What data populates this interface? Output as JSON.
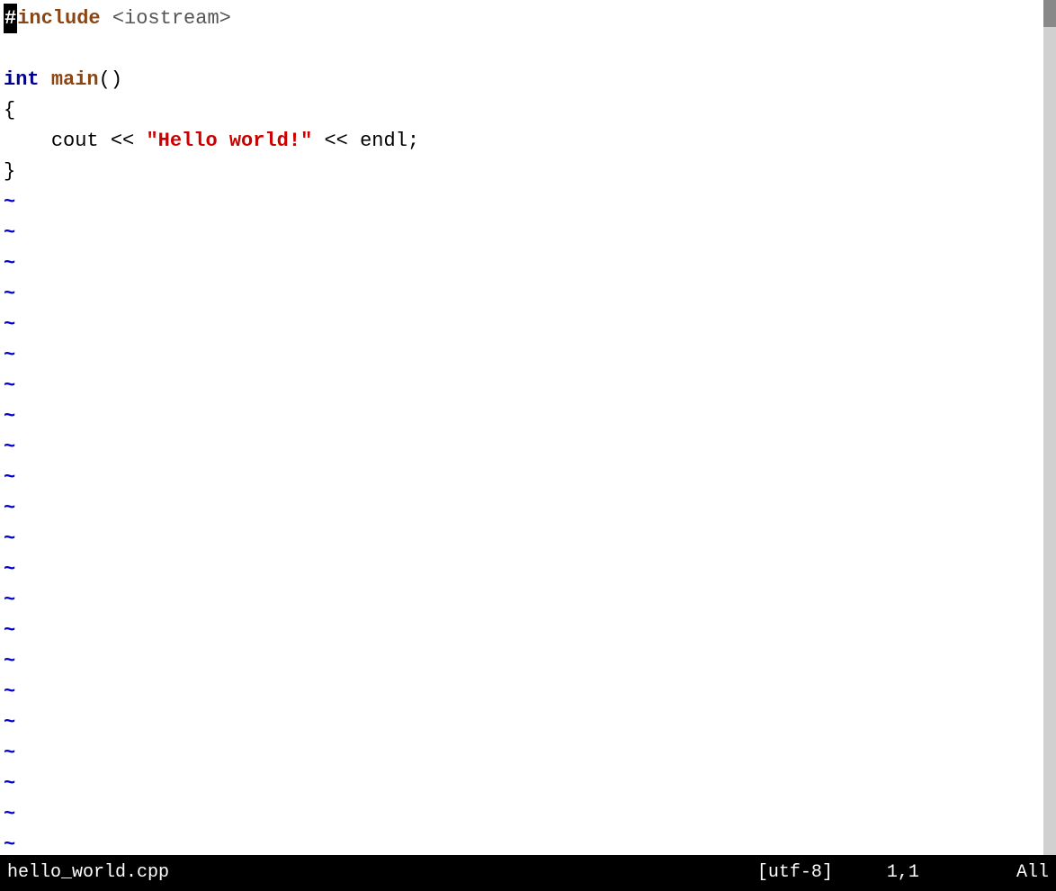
{
  "editor": {
    "background": "#ffffff",
    "lines": [
      {
        "type": "code",
        "content": "#include <iostream>"
      },
      {
        "type": "empty"
      },
      {
        "type": "code",
        "content": "int main()"
      },
      {
        "type": "code",
        "content": "{"
      },
      {
        "type": "code",
        "content": "    cout << \"Hello world!\" << endl;"
      },
      {
        "type": "code",
        "content": "}"
      }
    ],
    "tilde_count": 22
  },
  "statusbar": {
    "filename": "hello_world.cpp",
    "encoding": "[utf-8]",
    "position": "1,1",
    "view": "All"
  },
  "colors": {
    "hash_bg": "#000000",
    "hash_fg": "#ffffff",
    "keyword_int": "#00008b",
    "keyword_include": "#8b4513",
    "string": "#cc0000",
    "tilde": "#0000cc",
    "statusbar_bg": "#000000",
    "statusbar_fg": "#ffffff"
  }
}
